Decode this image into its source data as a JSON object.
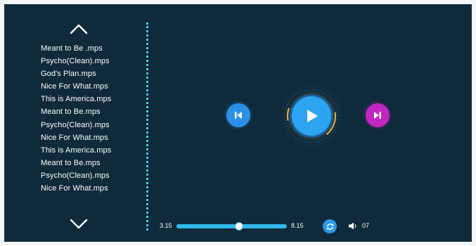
{
  "playlist": {
    "items": [
      {
        "label": "Meant to Be .mps"
      },
      {
        "label": "Psycho(Clean).mps"
      },
      {
        "label": "God's Plan.mps"
      },
      {
        "label": "Nice For What.mps"
      },
      {
        "label": "This is America.mps"
      },
      {
        "label": "Meant to Be.mps"
      },
      {
        "label": "Psycho(Clean).mps"
      },
      {
        "label": "Nice For What.mps"
      },
      {
        "label": "This is America.mps"
      },
      {
        "label": "Meant to Be.mps"
      },
      {
        "label": "Psycho(Clean).mps"
      },
      {
        "label": "Nice For What.mps"
      }
    ],
    "up_icon": "chevron-up-icon",
    "down_icon": "chevron-down-icon"
  },
  "transport": {
    "prev_icon": "skip-previous-icon",
    "play_icon": "play-icon",
    "next_icon": "skip-next-icon",
    "prev_color": "#2b8fe6",
    "play_color": "#2ca4f2",
    "next_color": "#c026c0"
  },
  "progress": {
    "current_time": "3.15",
    "total_time": "8.15",
    "position_fraction": 0.57
  },
  "repeat_icon": "repeat-icon",
  "volume": {
    "icon": "speaker-icon",
    "value": "07"
  },
  "colors": {
    "background": "#0f2a3b",
    "accent": "#35d2e6"
  }
}
